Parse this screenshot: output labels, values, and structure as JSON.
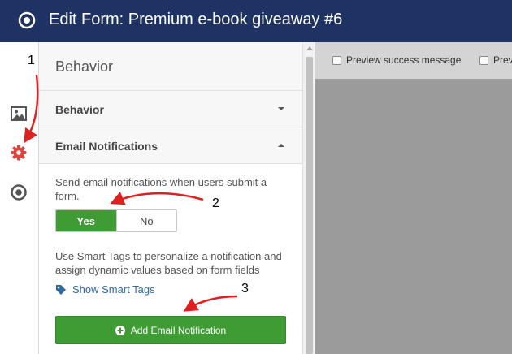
{
  "header": {
    "title": "Edit Form: Premium e-book giveaway #6",
    "logo_icon": "target-icon"
  },
  "sidebar_icons": [
    {
      "name": "image-icon"
    },
    {
      "name": "gear-icon",
      "active": true,
      "color": "#e0443e"
    },
    {
      "name": "target-icon"
    }
  ],
  "panel": {
    "title": "Behavior",
    "sections": {
      "behavior": {
        "label": "Behavior",
        "expanded": false
      },
      "email": {
        "label": "Email Notifications",
        "expanded": true
      }
    },
    "email_description": "Send email notifications when users submit a form.",
    "toggle": {
      "yes": "Yes",
      "no": "No",
      "selected": "Yes"
    },
    "smart_tags_description": "Use Smart Tags to personalize a notification and assign dynamic values based on form fields",
    "smart_tags_link": "Show Smart Tags",
    "add_button": "Add Email Notification"
  },
  "preview": {
    "options": [
      {
        "label": "Preview success message",
        "checked": false
      },
      {
        "label": "Previ",
        "checked": false
      }
    ]
  },
  "annotations": [
    "1",
    "2",
    "3"
  ],
  "colors": {
    "header_bg": "#1e3264",
    "accent_green": "#3f9c35",
    "active_icon": "#e0443e",
    "link_blue": "#3069a8",
    "annotation_red": "#e02020"
  }
}
